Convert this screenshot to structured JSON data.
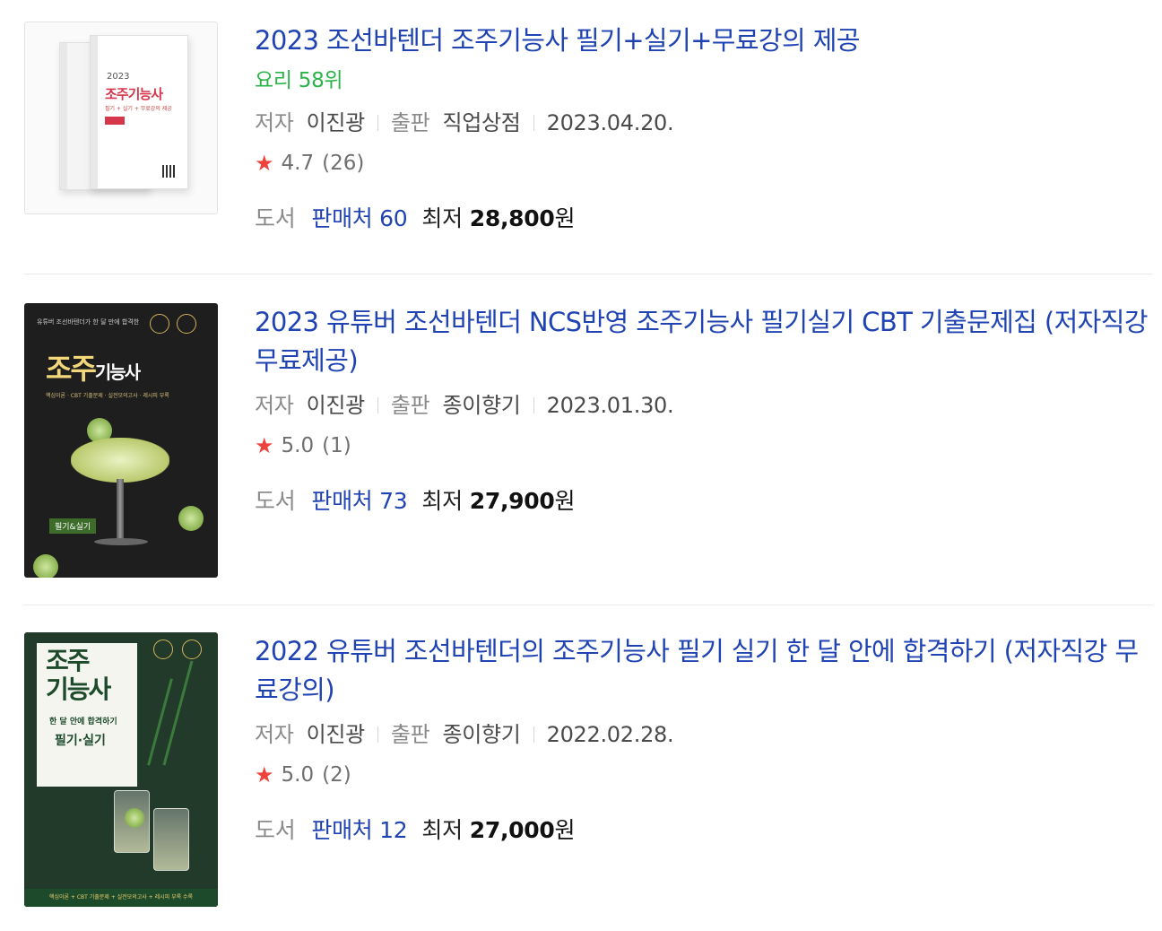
{
  "items": [
    {
      "title": "2023 조선바텐더 조주기능사 필기+실기+무료강의 제공",
      "rank": "요리 58위",
      "author_label": "저자",
      "author": "이진광",
      "publisher_label": "출판",
      "publisher": "직업상점",
      "date": "2023.04.20.",
      "rating": "4.7",
      "review_count": "(26)",
      "category": "도서",
      "sellers": "판매처 60",
      "lowest_label": "최저",
      "price": "28,800",
      "currency": "원",
      "cover": {
        "year": "2023",
        "title": "조주기능사",
        "sub": "필기 + 실기 + 무료강의 제공"
      }
    },
    {
      "title": "2023 유튜버 조선바텐더 NCS반영 조주기능사 필기실기 CBT 기출문제집 (저자직강 무료제공)",
      "author_label": "저자",
      "author": "이진광",
      "publisher_label": "출판",
      "publisher": "종이향기",
      "date": "2023.01.30.",
      "rating": "5.0",
      "review_count": "(1)",
      "category": "도서",
      "sellers": "판매처 73",
      "lowest_label": "최저",
      "price": "27,900",
      "currency": "원",
      "cover": {
        "top": "유튜버 조선바텐더가 한 달 만에 합격한",
        "title_a": "조주",
        "title_b": "기능사",
        "line": "핵심이론 · CBT 기출문제 · 실전모의고사 · 레시피 부록",
        "label": "필기&실기"
      }
    },
    {
      "title": "2022 유튜버 조선바텐더의 조주기능사 필기 실기 한 달 안에 합격하기 (저자직강 무료강의)",
      "author_label": "저자",
      "author": "이진광",
      "publisher_label": "출판",
      "publisher": "종이향기",
      "date": "2022.02.28.",
      "rating": "5.0",
      "review_count": "(2)",
      "category": "도서",
      "sellers": "판매처 12",
      "lowest_label": "최저",
      "price": "27,000",
      "currency": "원",
      "cover": {
        "title": "조주\n기능사",
        "sub": "한 달 안에 합격하기",
        "sub2": "필기·실기",
        "footer": "핵심이론 + CBT 기출문제 + 실전모의고사 + 레시피 부록 수록"
      }
    }
  ],
  "star_icon": "★",
  "colors": {
    "title": "#1f43b3",
    "rank": "#2bb34a",
    "star": "#f0423c"
  }
}
